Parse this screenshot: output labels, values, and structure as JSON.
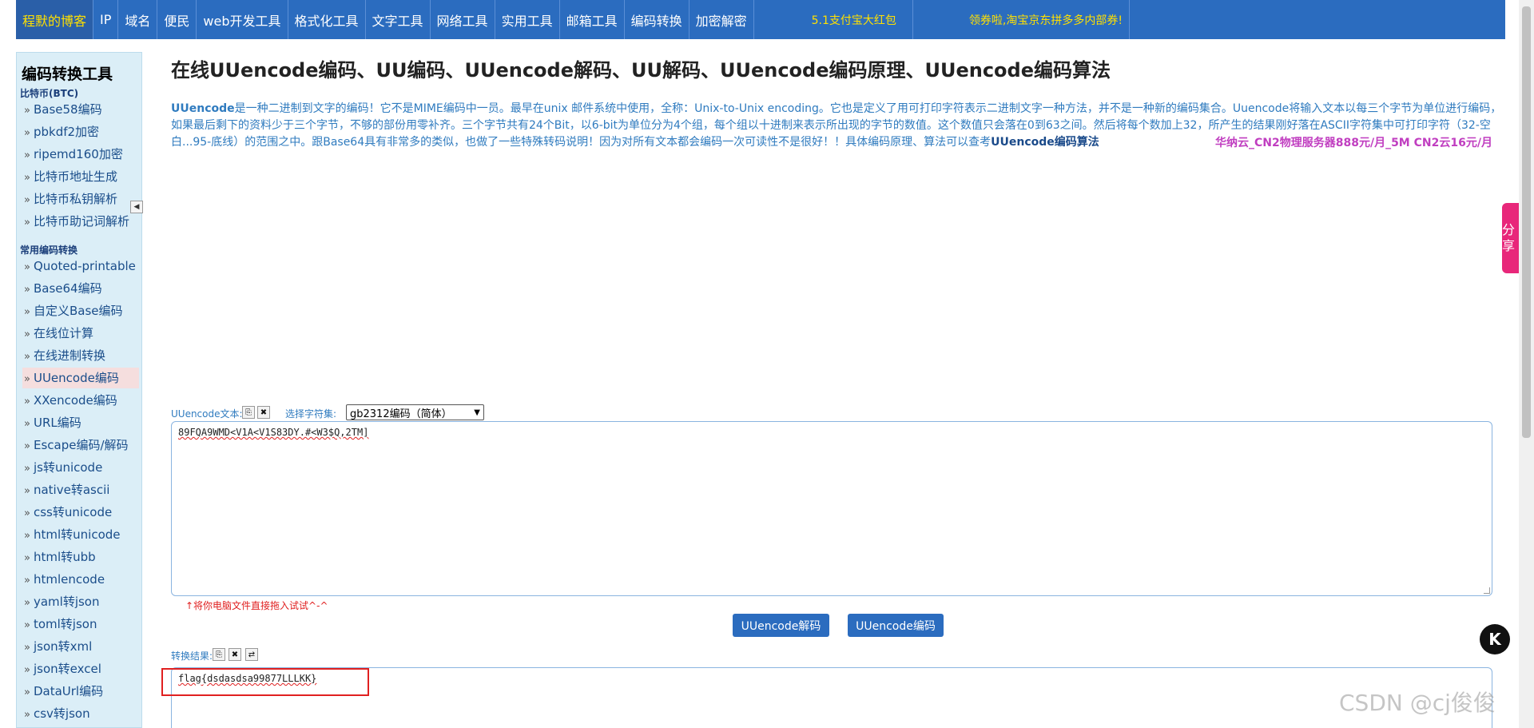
{
  "nav": {
    "brand": "程默的博客",
    "items": [
      "IP",
      "域名",
      "便民",
      "web开发工具",
      "格式化工具",
      "文字工具",
      "网络工具",
      "实用工具",
      "邮箱工具",
      "编码转换",
      "加密解密"
    ],
    "promo1": "5.1支付宝大红包",
    "promo2": "领券啦,淘宝京东拼多多内部券!"
  },
  "sidebar": {
    "title": "编码转换工具",
    "section1": "比特币(BTC)",
    "btc_items": [
      "Base58编码",
      "pbkdf2加密",
      "ripemd160加密",
      "比特币地址生成",
      "比特币私钥解析",
      "比特币助记词解析"
    ],
    "section2": "常用编码转换",
    "common_items": [
      "Quoted-printable",
      "Base64编码",
      "自定义Base编码",
      "在线位计算",
      "在线进制转换",
      "UUencode编码",
      "XXencode编码",
      "URL编码",
      "Escape编码/解码",
      "js转unicode",
      "native转ascii",
      "css转unicode",
      "html转unicode",
      "html转ubb",
      "htmlencode",
      "yaml转json",
      "toml转json",
      "json转xml",
      "json转excel",
      "DataUrl编码",
      "csv转json"
    ],
    "active": "UUencode编码"
  },
  "main": {
    "title": "在线UUencode编码、UU编码、UUencode解码、UU解码、UUencode编码原理、UUencode编码算法",
    "intro_keyword": "UUencode",
    "intro_text": "是一种二进制到文字的编码！它不是MIME编码中一员。最早在unix 邮件系统中使用，全称：Unix-to-Unix encoding。它也是定义了用可打印字符表示二进制文字一种方法，并不是一种新的编码集合。Uuencode将输入文本以每三个字节为单位进行编码，如果最后剩下的资料少于三个字节，不够的部份用零补齐。三个字节共有24个Bit，以6-bit为单位分为4个组，每个组以十进制来表示所出现的字节的数值。这个数值只会落在0到63之间。然后将每个数加上32，所产生的结果刚好落在ASCII字符集中可打印字符（32-空白...95-底线）的范围之中。跟Base64具有非常多的类似，也做了一些特殊转码说明！因为对所有文本都会编码一次可读性不是很好！！具体编码原理、算法可以查考",
    "intro_link": "UUencode编码算法",
    "ad": "华纳云_CN2物理服务器888元/月_5M CN2云16元/月",
    "input_label": "UUencode文本:",
    "charset_label": "选择字符集:",
    "charset_value": "gb2312编码（简体）",
    "input_text": "89FQA9WMD<V1A<V1S83DY.#<W3$Q,2TM]",
    "drag_hint": "↑将你电脑文件直接拖入试试^-^",
    "decode_button": "UUencode解码",
    "encode_button": "UUencode编码",
    "result_label": "转换结果:",
    "output_text": "flag{dsdasdsa99877LLLKK}"
  },
  "share": "分享",
  "float_icon": "K",
  "watermark": "CSDN @cj俊俊",
  "icons": {
    "copy": "copy-icon",
    "clear": "clear-icon",
    "swap": "swap-icon",
    "collapse": "caret-left-icon"
  },
  "colors": {
    "nav_bg": "#2b6cbf",
    "brand_text": "#ffe000",
    "sidebar_bg": "#dbeef7",
    "active_item_bg": "#f5dede",
    "button_bg": "#2b6cbf",
    "highlight": "#e02020",
    "share_bg": "#e8277a",
    "ad_text": "#c03ec0"
  }
}
